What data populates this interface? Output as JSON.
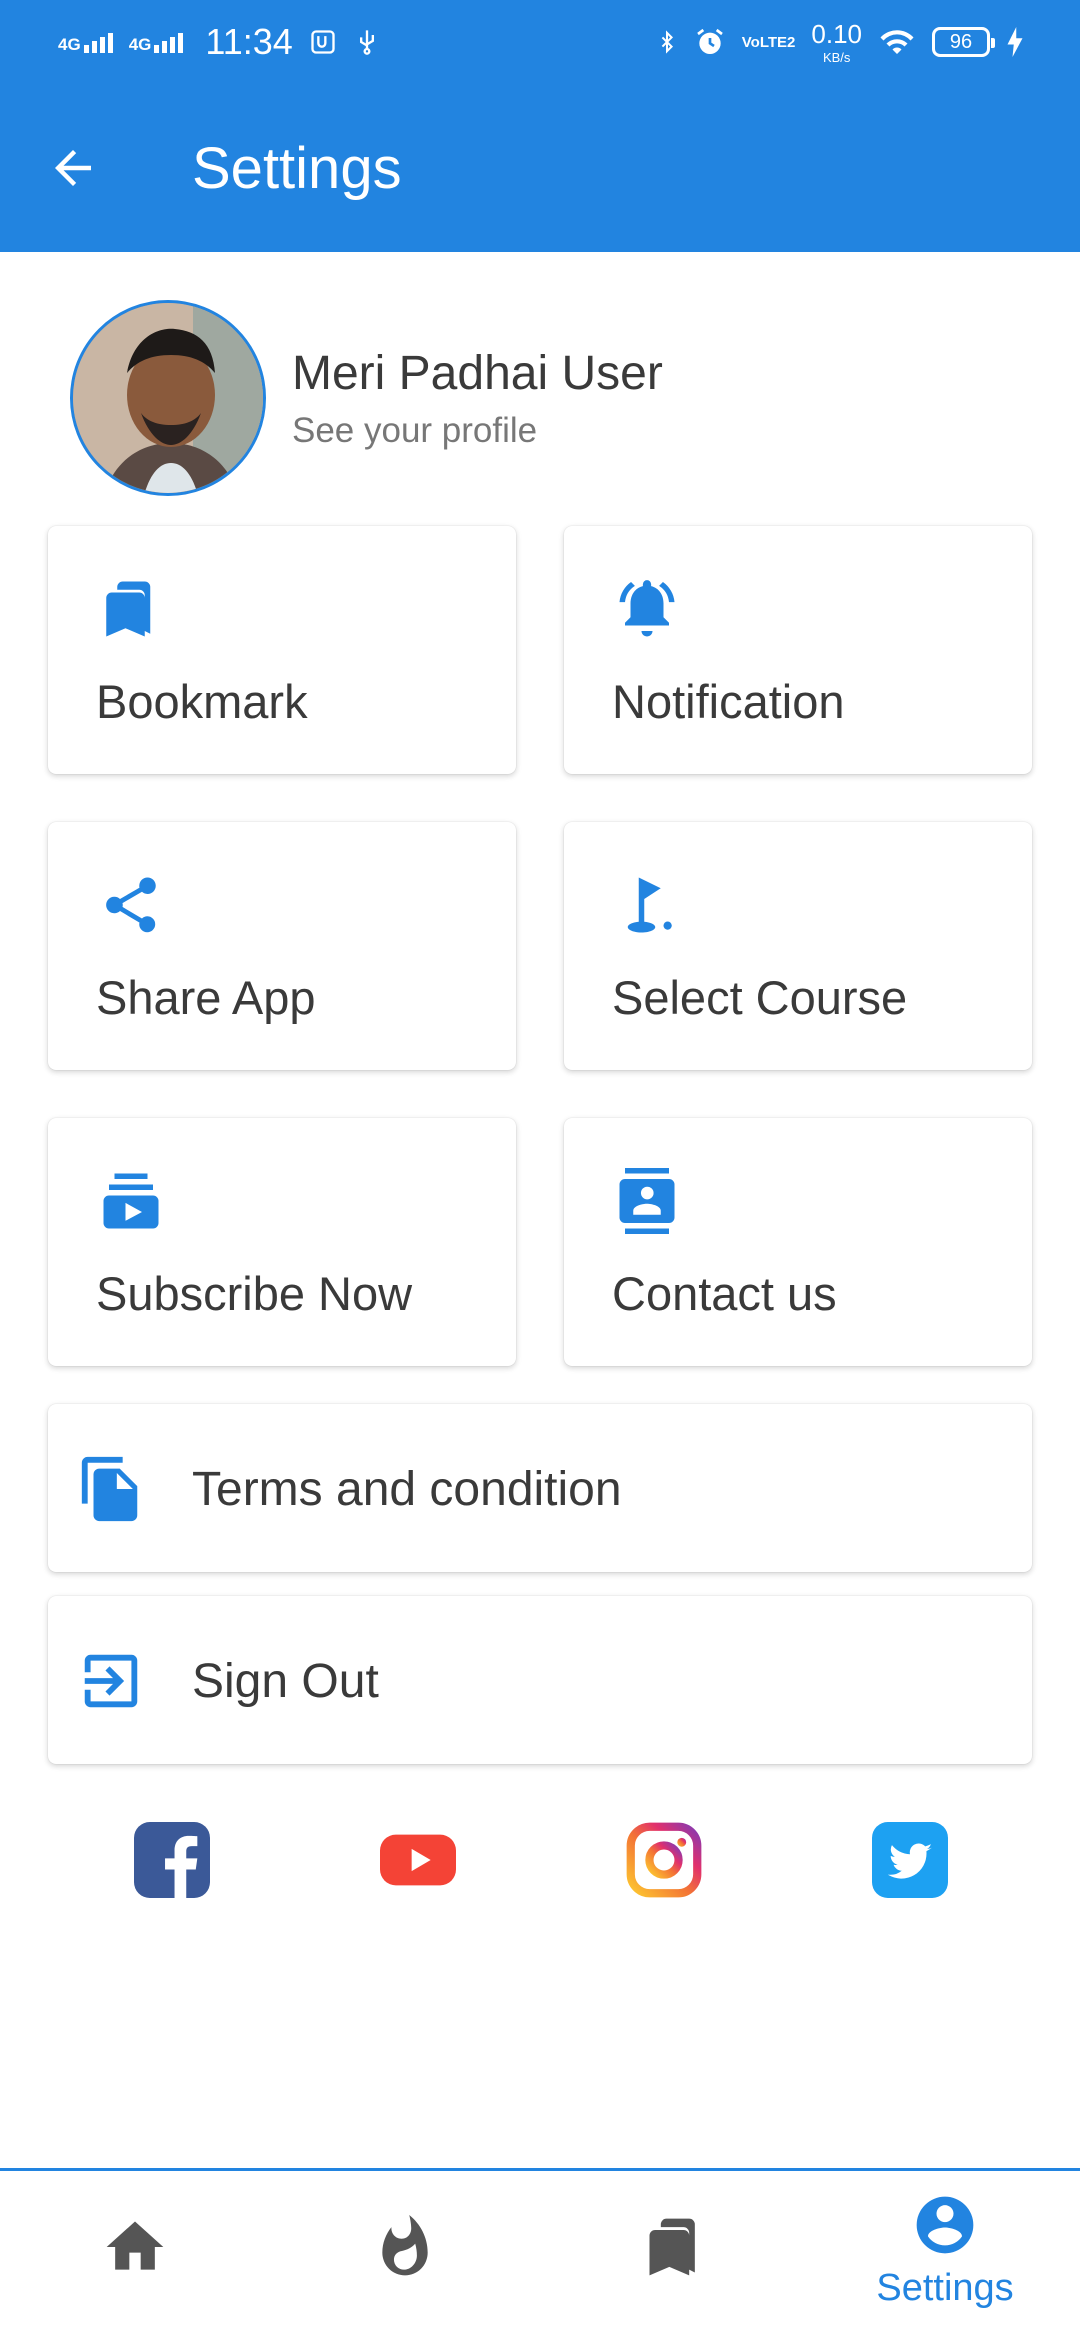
{
  "status_bar": {
    "network1": "4G",
    "network2": "4G",
    "time": "11:34",
    "volte": "VoLTE2",
    "speed_value": "0.10",
    "speed_unit": "KB/s",
    "battery": "96"
  },
  "header": {
    "title": "Settings",
    "back_icon": "arrow-left-icon"
  },
  "profile": {
    "name": "Meri Padhai User",
    "subtitle": "See your profile"
  },
  "tiles": [
    {
      "label": "Bookmark",
      "icon": "bookmark-icon"
    },
    {
      "label": "Notification",
      "icon": "bell-icon"
    },
    {
      "label": "Share App",
      "icon": "share-icon"
    },
    {
      "label": "Select Course",
      "icon": "golf-flag-icon"
    },
    {
      "label": "Subscribe Now",
      "icon": "subscriptions-icon"
    },
    {
      "label": "Contact us",
      "icon": "contact-card-icon"
    }
  ],
  "rows": [
    {
      "label": "Terms and condition",
      "icon": "file-copy-icon"
    },
    {
      "label": "Sign Out",
      "icon": "exit-icon"
    }
  ],
  "social": [
    "facebook-icon",
    "youtube-icon",
    "instagram-icon",
    "twitter-icon"
  ],
  "bottom_nav": [
    {
      "icon": "home-icon",
      "label": ""
    },
    {
      "icon": "flame-icon",
      "label": ""
    },
    {
      "icon": "bookmarks-icon",
      "label": ""
    },
    {
      "icon": "account-icon",
      "label": "Settings",
      "active": true
    }
  ],
  "colors": {
    "primary": "#2284e0",
    "text": "#3a3a3a",
    "subtext": "#777777",
    "nav_inactive": "#555555"
  }
}
